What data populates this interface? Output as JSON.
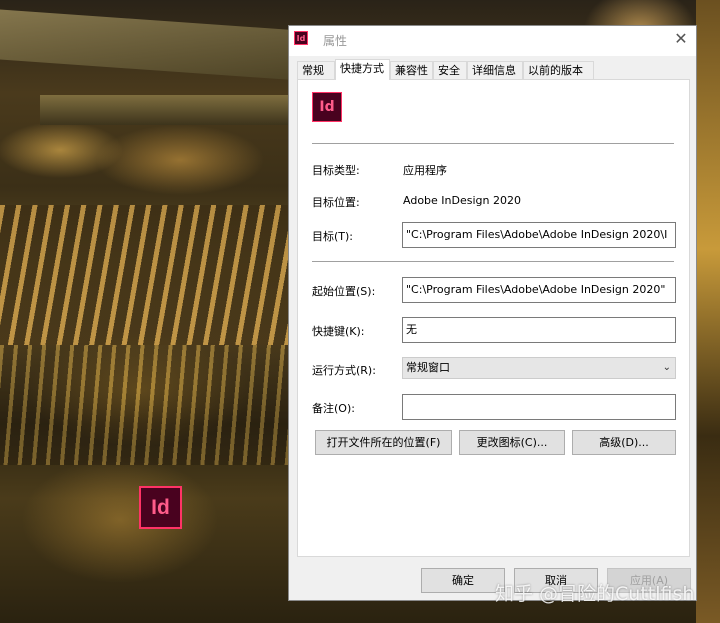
{
  "desktop": {
    "icon_label": "Id"
  },
  "dialog": {
    "title": "属性",
    "title_icon": "Id",
    "close": "✕",
    "tabs": [
      "常规",
      "快捷方式",
      "兼容性",
      "安全",
      "详细信息",
      "以前的版本"
    ],
    "active_tab": "快捷方式",
    "app_icon": "Id",
    "fields": {
      "target_type_label": "目标类型:",
      "target_type_value": "应用程序",
      "target_location_label": "目标位置:",
      "target_location_value": "Adobe InDesign 2020",
      "target_label": "目标(T):",
      "target_value": "\"C:\\Program Files\\Adobe\\Adobe InDesign 2020\\I",
      "start_in_label": "起始位置(S):",
      "start_in_value": "\"C:\\Program Files\\Adobe\\Adobe InDesign 2020\"",
      "shortcut_key_label": "快捷键(K):",
      "shortcut_key_value": "无",
      "run_label": "运行方式(R):",
      "run_value": "常规窗口",
      "comment_label": "备注(O):",
      "comment_value": ""
    },
    "buttons": {
      "open_location": "打开文件所在的位置(F)",
      "change_icon": "更改图标(C)...",
      "advanced": "高级(D)...",
      "ok": "确定",
      "cancel": "取消",
      "apply": "应用(A)"
    }
  },
  "watermark": "知乎 @冒险的Cuttlfish"
}
